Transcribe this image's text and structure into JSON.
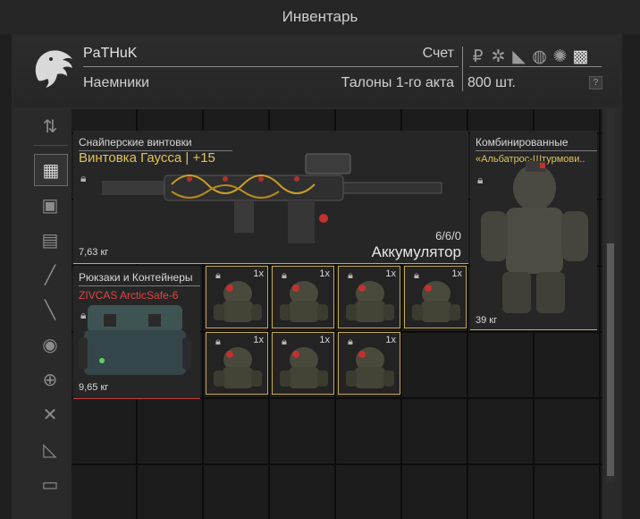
{
  "window": {
    "title": "Инвентарь"
  },
  "header": {
    "user": "PaTHuK",
    "faction": "Наемники",
    "score_label": "Счет",
    "coupons_label": "Талоны 1-го акта",
    "coupons_amount": "800 шт.",
    "help": "?",
    "currency_icons": [
      "ruble-icon",
      "gear-bolt-icon",
      "boot-icon",
      "compass-icon",
      "splat-icon",
      "badge-icon"
    ]
  },
  "sidebar": {
    "items": [
      {
        "name": "sort-icon",
        "glyph": "⇅"
      },
      {
        "name": "grid-all-icon",
        "glyph": "▦",
        "active": true
      },
      {
        "name": "vest-icon",
        "glyph": "▣"
      },
      {
        "name": "backpack-icon",
        "glyph": "▤"
      },
      {
        "name": "rifle-icon",
        "glyph": "╱"
      },
      {
        "name": "pistol-icon",
        "glyph": "╲"
      },
      {
        "name": "grenade-icon",
        "glyph": "◉"
      },
      {
        "name": "medkit-icon",
        "glyph": "⊕"
      },
      {
        "name": "tools-icon",
        "glyph": "✕"
      },
      {
        "name": "ruler-icon",
        "glyph": "◺"
      },
      {
        "name": "box-icon",
        "glyph": "▭"
      }
    ]
  },
  "items": {
    "rifle": {
      "category": "Снайперские винтовки",
      "name": "Винтовка Гаусса | +15",
      "name_color": "#e3c25a",
      "weight": "7,63 кг",
      "ammo": "6/6/0",
      "ammo_type": "Аккумулятор"
    },
    "armor": {
      "category": "Комбинированные",
      "name": "«Альбатрос-Штурмови..",
      "name_color": "#e3c25a",
      "weight": "39 кг"
    },
    "container": {
      "category": "Рюкзаки и Контейнеры",
      "name": "ZIVCAS ArcticSafe-6",
      "name_color": "#e04545",
      "weight": "9,65 кг"
    },
    "small_items": [
      {
        "count": "1x"
      },
      {
        "count": "1x"
      },
      {
        "count": "1x"
      },
      {
        "count": "1x"
      },
      {
        "count": "1x"
      },
      {
        "count": "1x"
      },
      {
        "count": "1x"
      }
    ]
  }
}
